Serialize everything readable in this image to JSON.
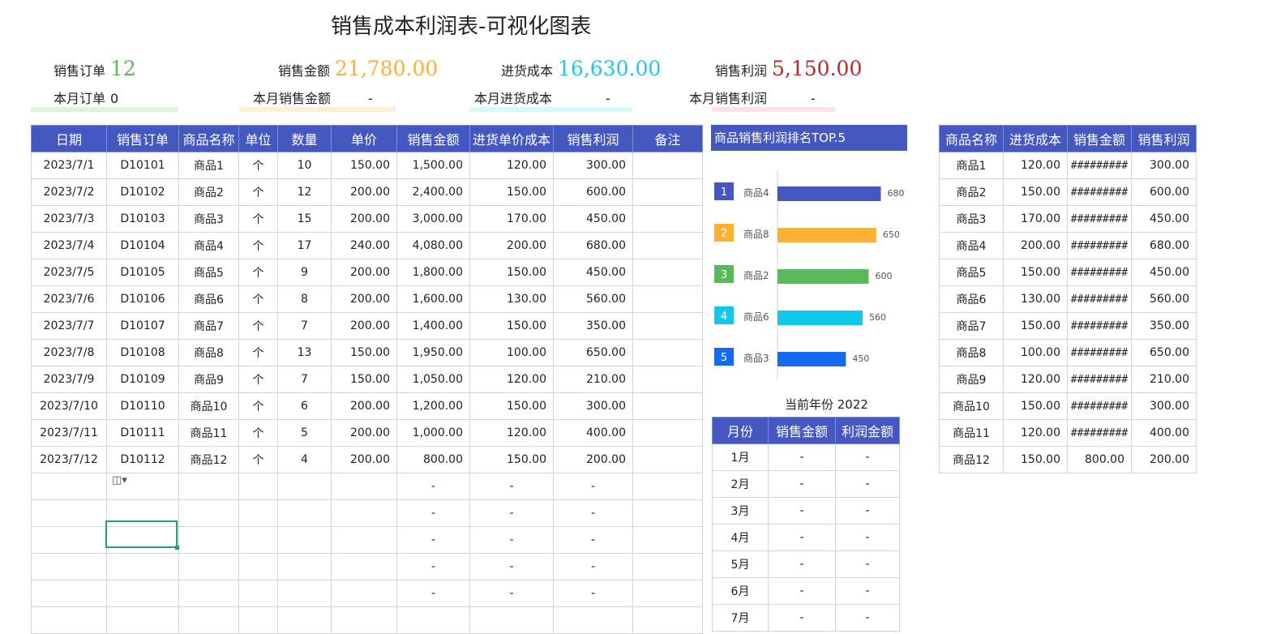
{
  "title": "销售成本利润表-可视化图表",
  "kpis": [
    {
      "label": "销售订单",
      "value": "12",
      "color": "#5cb85c"
    },
    {
      "label": "销售金额",
      "value": "21,780.00",
      "color": "#f5b041"
    },
    {
      "label": "进货成本",
      "value": "16,630.00",
      "color": "#1ec8e6"
    },
    {
      "label": "销售利润",
      "value": "5,150.00",
      "color": "#c0262c"
    }
  ],
  "monthly": [
    {
      "label": "本月订单",
      "value": "0"
    },
    {
      "label": "本月销售金额",
      "value": "-"
    },
    {
      "label": "本月进货成本",
      "value": "-"
    },
    {
      "label": "本月销售利润",
      "value": "-"
    }
  ],
  "main_table": {
    "headers": [
      "日期",
      "销售订单",
      "商品名称",
      "单位",
      "数量",
      "单价",
      "销售金额",
      "进货单价成本",
      "销售利润",
      "备注"
    ],
    "rows": [
      [
        "2023/7/1",
        "D10101",
        "商品1",
        "个",
        "10",
        "150.00",
        "1,500.00",
        "120.00",
        "300.00",
        ""
      ],
      [
        "2023/7/2",
        "D10102",
        "商品2",
        "个",
        "12",
        "200.00",
        "2,400.00",
        "150.00",
        "600.00",
        ""
      ],
      [
        "2023/7/3",
        "D10103",
        "商品3",
        "个",
        "15",
        "200.00",
        "3,000.00",
        "170.00",
        "450.00",
        ""
      ],
      [
        "2023/7/4",
        "D10104",
        "商品4",
        "个",
        "17",
        "240.00",
        "4,080.00",
        "200.00",
        "680.00",
        ""
      ],
      [
        "2023/7/5",
        "D10105",
        "商品5",
        "个",
        "9",
        "200.00",
        "1,800.00",
        "150.00",
        "450.00",
        ""
      ],
      [
        "2023/7/6",
        "D10106",
        "商品6",
        "个",
        "8",
        "200.00",
        "1,600.00",
        "130.00",
        "560.00",
        ""
      ],
      [
        "2023/7/7",
        "D10107",
        "商品7",
        "个",
        "7",
        "200.00",
        "1,400.00",
        "150.00",
        "350.00",
        ""
      ],
      [
        "2023/7/8",
        "D10108",
        "商品8",
        "个",
        "13",
        "150.00",
        "1,950.00",
        "100.00",
        "650.00",
        ""
      ],
      [
        "2023/7/9",
        "D10109",
        "商品9",
        "个",
        "7",
        "150.00",
        "1,050.00",
        "120.00",
        "210.00",
        ""
      ],
      [
        "2023/7/10",
        "D10110",
        "商品10",
        "个",
        "6",
        "200.00",
        "1,200.00",
        "150.00",
        "300.00",
        ""
      ],
      [
        "2023/7/11",
        "D10111",
        "商品11",
        "个",
        "5",
        "200.00",
        "1,000.00",
        "120.00",
        "400.00",
        ""
      ],
      [
        "2023/7/12",
        "D10112",
        "商品12",
        "个",
        "4",
        "200.00",
        "800.00",
        "150.00",
        "200.00",
        ""
      ],
      [
        "",
        "",
        "",
        "",
        "",
        "",
        "-",
        "-",
        "-",
        ""
      ],
      [
        "",
        "",
        "",
        "",
        "",
        "",
        "-",
        "-",
        "-",
        ""
      ],
      [
        "",
        "",
        "",
        "",
        "",
        "",
        "-",
        "-",
        "-",
        ""
      ],
      [
        "",
        "",
        "",
        "",
        "",
        "",
        "-",
        "-",
        "-",
        ""
      ],
      [
        "",
        "",
        "",
        "",
        "",
        "",
        "-",
        "-",
        "-",
        ""
      ],
      [
        "",
        "",
        "",
        "",
        "",
        "",
        "",
        "",
        "",
        ""
      ]
    ]
  },
  "chart_data": {
    "type": "bar",
    "title": "商品销售利润排名TOP.5",
    "ranks": [
      "1",
      "2",
      "3",
      "4",
      "5"
    ],
    "categories": [
      "商品4",
      "商品8",
      "商品2",
      "商品6",
      "商品3"
    ],
    "values": [
      680,
      650,
      600,
      560,
      450
    ],
    "colors": [
      "#4458c0",
      "#f9b233",
      "#5cb85c",
      "#10c8ea",
      "#1668f0"
    ],
    "xlim": [
      0,
      800
    ]
  },
  "year_label": "当前年份 2022",
  "month_table": {
    "headers": [
      "月份",
      "销售金额",
      "利润金额"
    ],
    "rows": [
      [
        "1月",
        "-",
        "-"
      ],
      [
        "2月",
        "-",
        "-"
      ],
      [
        "3月",
        "-",
        "-"
      ],
      [
        "4月",
        "-",
        "-"
      ],
      [
        "5月",
        "-",
        "-"
      ],
      [
        "6月",
        "-",
        "-"
      ],
      [
        "7月",
        "-",
        "-"
      ]
    ]
  },
  "product_table": {
    "headers": [
      "商品名称",
      "进货成本",
      "销售金额",
      "销售利润"
    ],
    "rows": [
      [
        "商品1",
        "120.00",
        "#########",
        "300.00"
      ],
      [
        "商品2",
        "150.00",
        "#########",
        "600.00"
      ],
      [
        "商品3",
        "170.00",
        "#########",
        "450.00"
      ],
      [
        "商品4",
        "200.00",
        "#########",
        "680.00"
      ],
      [
        "商品5",
        "150.00",
        "#########",
        "450.00"
      ],
      [
        "商品6",
        "130.00",
        "#########",
        "560.00"
      ],
      [
        "商品7",
        "150.00",
        "#########",
        "350.00"
      ],
      [
        "商品8",
        "100.00",
        "#########",
        "650.00"
      ],
      [
        "商品9",
        "120.00",
        "#########",
        "210.00"
      ],
      [
        "商品10",
        "150.00",
        "#########",
        "300.00"
      ],
      [
        "商品11",
        "120.00",
        "#########",
        "400.00"
      ],
      [
        "商品12",
        "150.00",
        "800.00",
        "200.00"
      ]
    ]
  }
}
